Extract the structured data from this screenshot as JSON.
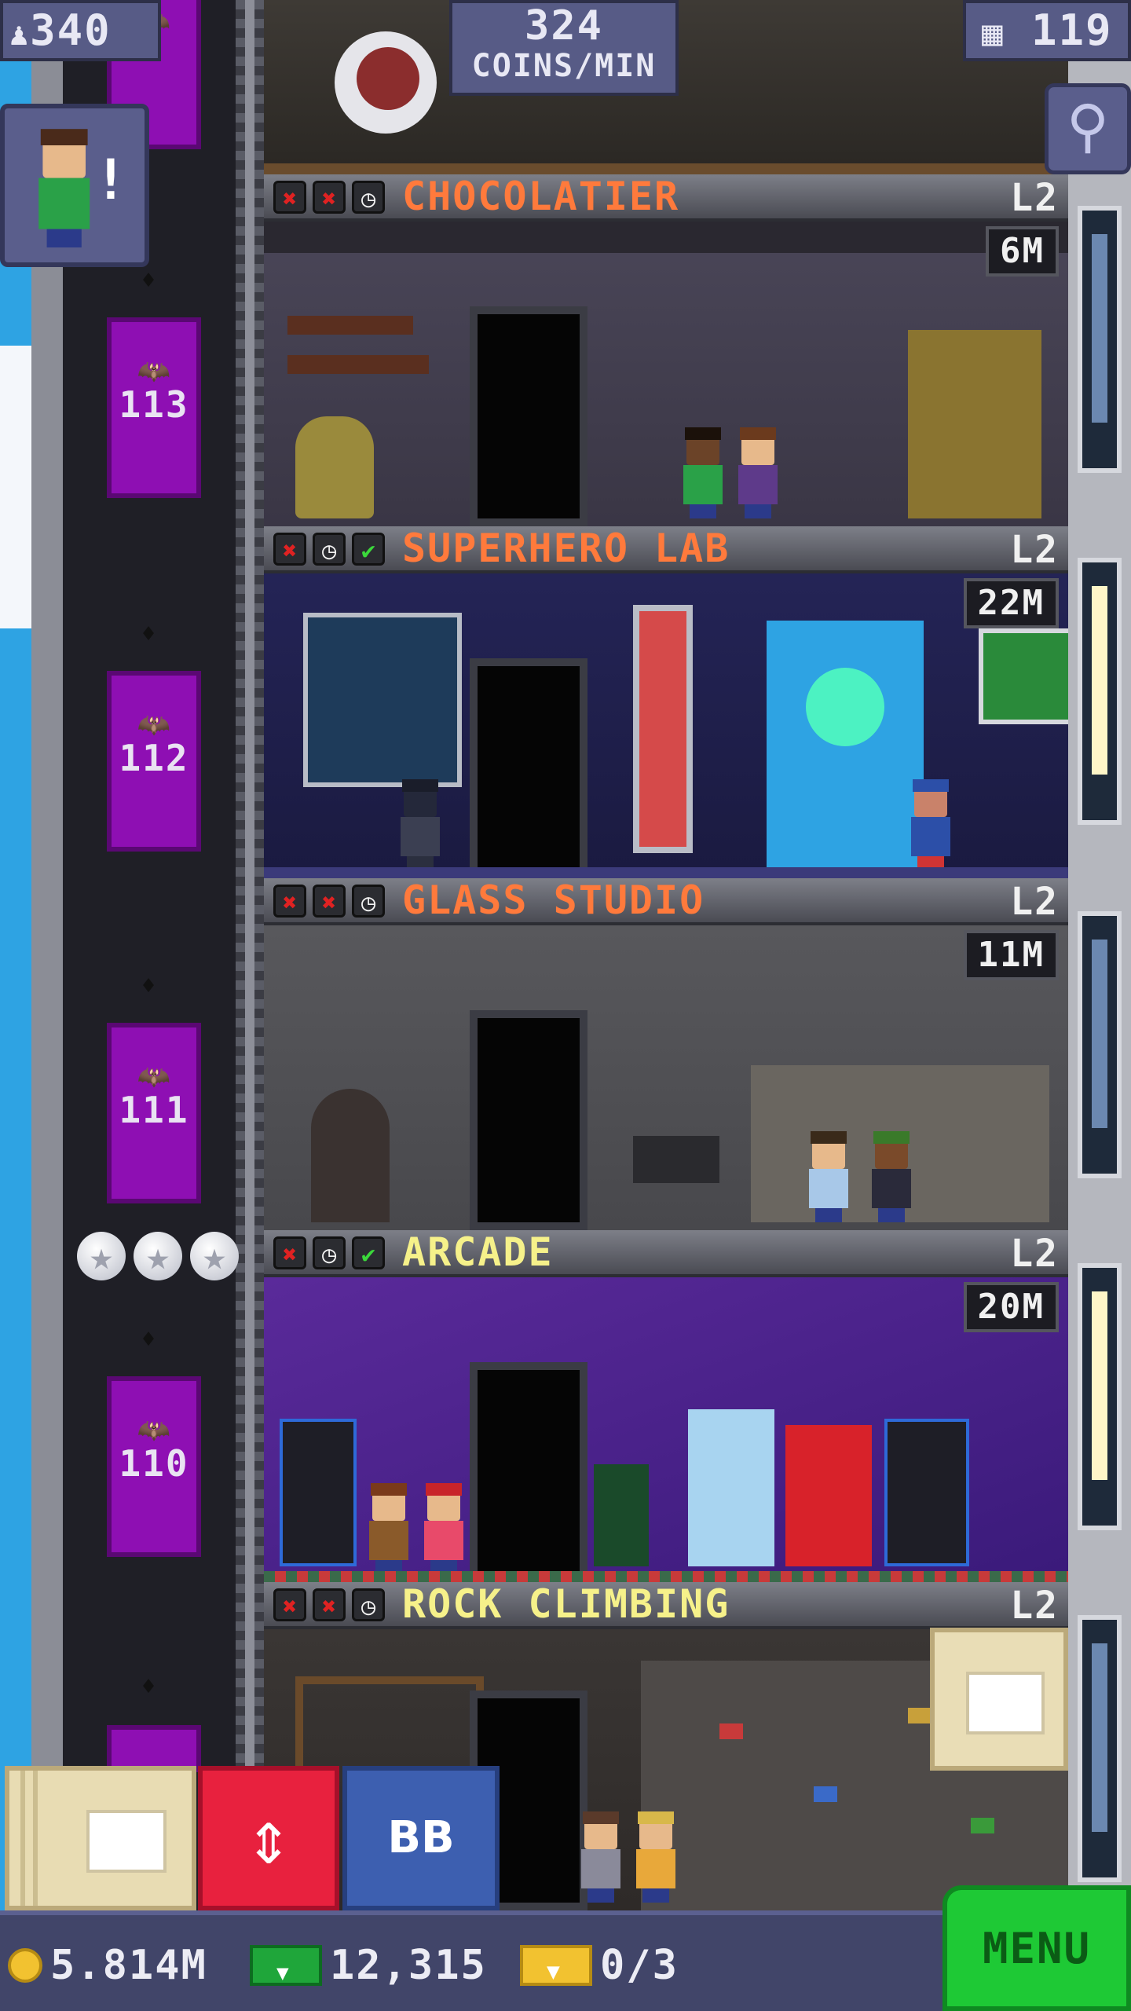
{
  "hud": {
    "population": "340",
    "coins_per_min_value": "324",
    "coins_per_min_label": "COINS/MIN",
    "floors": "119"
  },
  "icons": {
    "population": "person-icon",
    "floors": "building-icon",
    "zoom": "magnifier-icon",
    "coin": "coin-icon",
    "bux": "bux-icon",
    "ticket": "golden-ticket-icon"
  },
  "elevator": {
    "floor_numbers": [
      "113",
      "112",
      "111",
      "110"
    ]
  },
  "floors": [
    {
      "name": "CHOCOLATIER",
      "level": "L2",
      "income": "6M",
      "status": [
        "x",
        "x",
        "clock"
      ],
      "name_color": "#ff7a3c"
    },
    {
      "name": "SUPERHERO LAB",
      "level": "L2",
      "income": "22M",
      "status": [
        "x",
        "clock",
        "check"
      ],
      "name_color": "#ff7a3c"
    },
    {
      "name": "GLASS STUDIO",
      "level": "L2",
      "income": "11M",
      "status": [
        "x",
        "x",
        "clock"
      ],
      "name_color": "#ff7a3c"
    },
    {
      "name": "ARCADE",
      "level": "L2",
      "income": "20M",
      "status": [
        "x",
        "clock",
        "check"
      ],
      "name_color": "#f6f18a"
    },
    {
      "name": "ROCK CLIMBING",
      "level": "L2",
      "income": "",
      "status": [
        "x",
        "x",
        "clock"
      ],
      "name_color": "#f6f18a"
    }
  ],
  "buttons": {
    "bb": "BB",
    "menu": "MENU"
  },
  "status": {
    "coins": "5.814M",
    "bux": "12,315",
    "tickets": "0/3"
  },
  "colors": {
    "elevator": "#8e0fb3",
    "menu": "#1ec935",
    "elevator_button": "#e8213e",
    "bb_button": "#3d5fb0"
  }
}
